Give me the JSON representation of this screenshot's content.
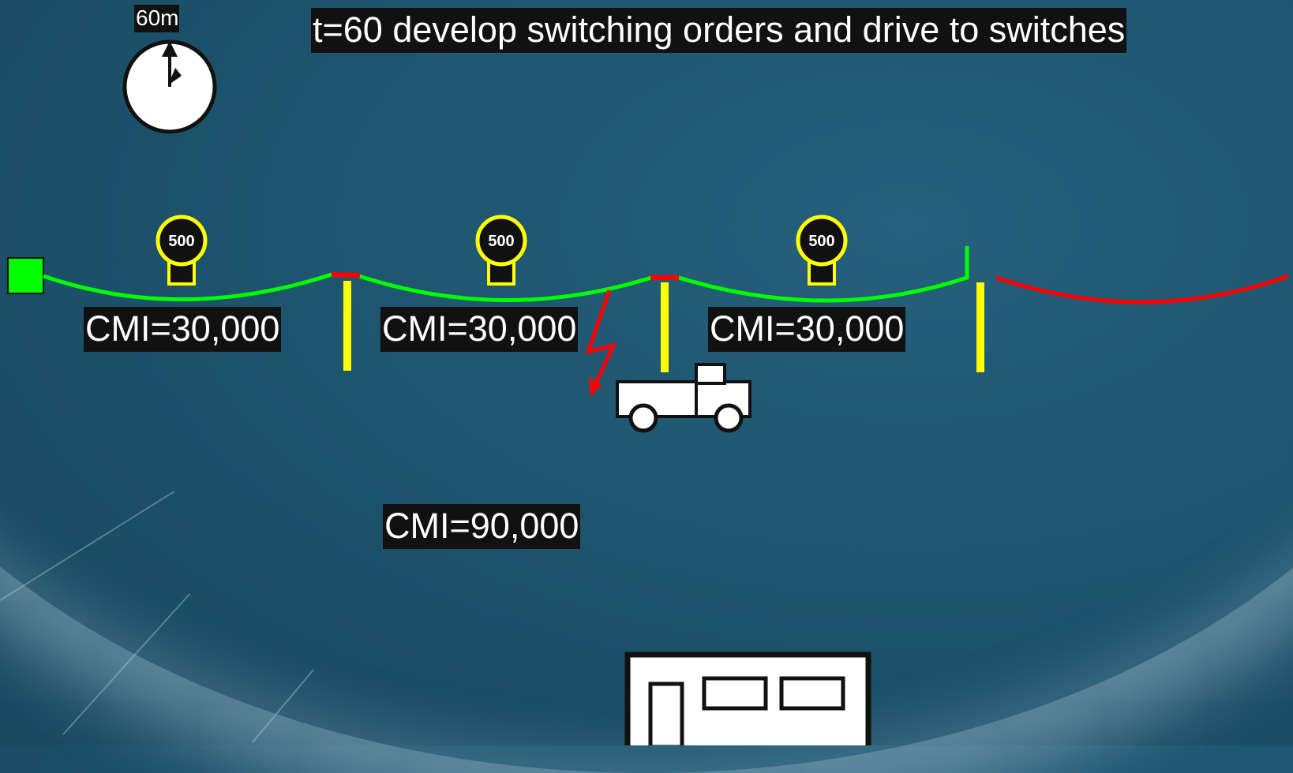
{
  "clock": {
    "label": "60m",
    "icon": "clock-icon"
  },
  "title": "t=60 develop switching orders and drive to switches",
  "loads": [
    {
      "value": "500",
      "icon": "lightbulb-icon"
    },
    {
      "value": "500",
      "icon": "lightbulb-icon"
    },
    {
      "value": "500",
      "icon": "lightbulb-icon"
    }
  ],
  "cmi": {
    "section_1": "CMI=30,000",
    "section_2": "CMI=30,000",
    "section_3": "CMI=30,000",
    "total": "CMI=90,000"
  },
  "colors": {
    "energized": "#00ff00",
    "deenergized": "#ff0000",
    "switch": "#ffff00",
    "substation": "#00ff00",
    "fault": "#ff0000",
    "label_bg": "#111111",
    "background": "#1f5670"
  },
  "icons": [
    "substation-icon",
    "switch-icon",
    "fault-icon",
    "truck-icon",
    "building-icon"
  ]
}
